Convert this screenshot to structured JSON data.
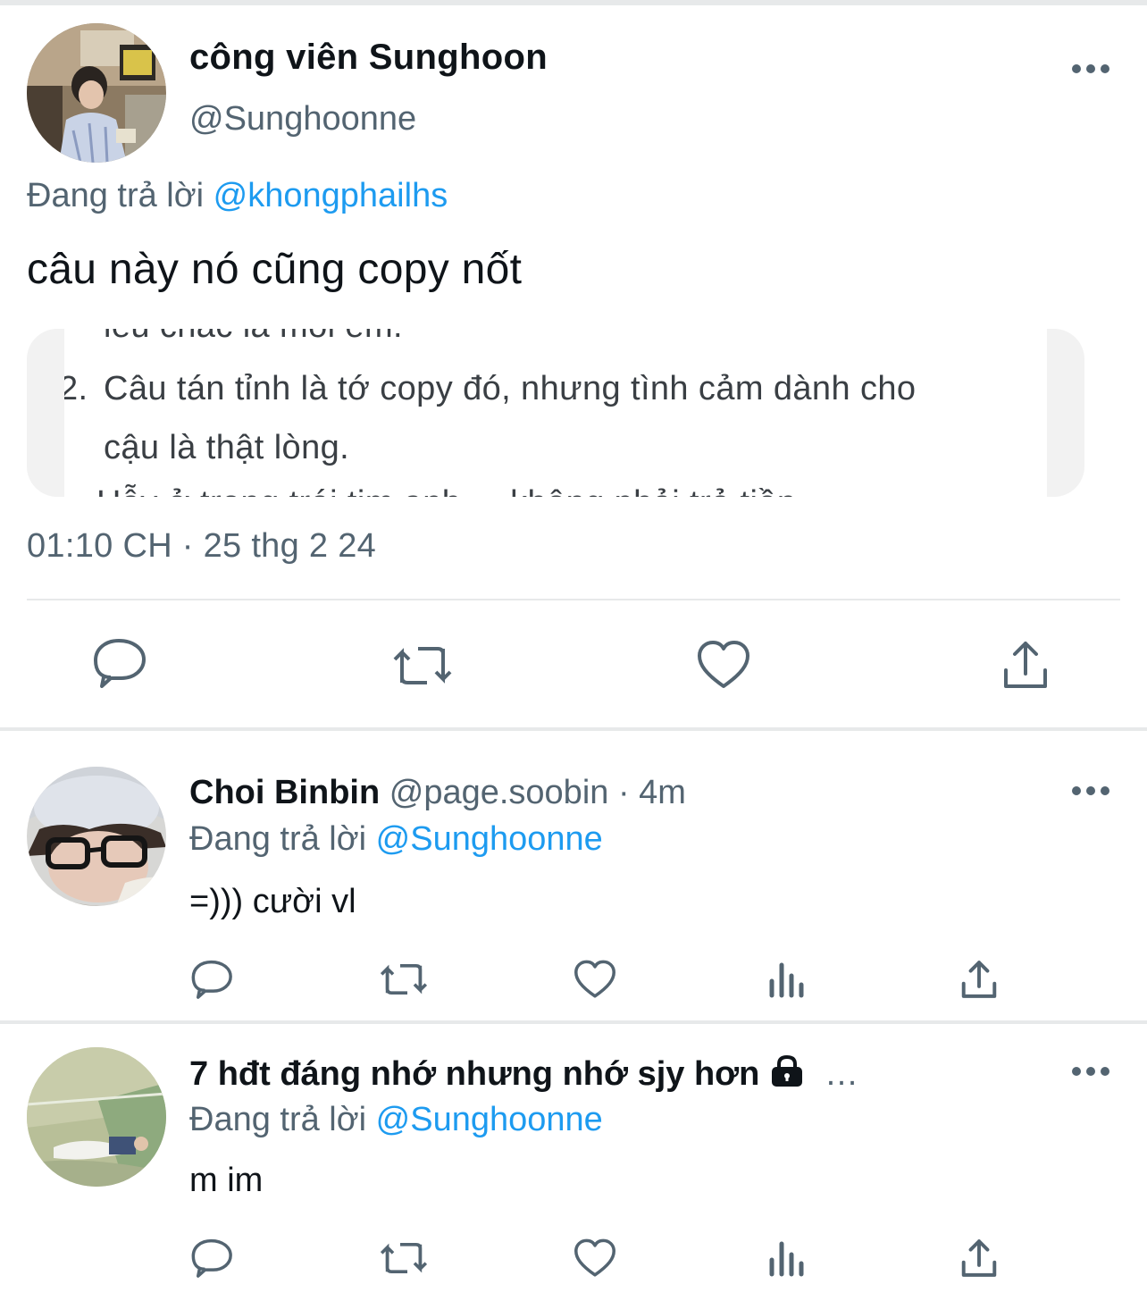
{
  "main_tweet": {
    "author_name": "công viên Sunghoon",
    "author_handle": "@Sunghoonne",
    "replying_prefix": "Đang trả lời",
    "replying_to": "@khongphailhs",
    "text": "câu này nó cũng copy nốt",
    "media": {
      "line_partial_top": "ieu chac la moi em.",
      "list_number": "2.",
      "line1": "Câu tán tỉnh là tớ copy đó, nhưng tình cảm dành cho",
      "line2": "cậu là thật lòng.",
      "line_partial_bottom": "Hẫy ở trọng trái tim anh ... không phải trả tiền ..."
    },
    "timestamp": "01:10 CH · 25 thg 2 24",
    "actions": [
      "reply-icon",
      "retweet-icon",
      "like-icon",
      "share-icon"
    ]
  },
  "replies": [
    {
      "author_name": "Choi Binbin",
      "author_handle": "@page.soobin",
      "age": " · 4m",
      "replying_prefix": "Đang trả lời",
      "replying_to": "@Sunghoonne",
      "text": "=))) cười vl",
      "actions": [
        "reply-icon",
        "retweet-icon",
        "like-icon",
        "views-icon",
        "share-icon"
      ]
    },
    {
      "author_name": "7 hđt đáng nhớ nhưng nhớ sjy hơn",
      "author_suffix": "…",
      "protected": true,
      "replying_prefix": "Đang trả lời",
      "replying_to": "@Sunghoonne",
      "text": "m im",
      "actions": [
        "reply-icon",
        "retweet-icon",
        "like-icon",
        "views-icon",
        "share-icon"
      ]
    }
  ],
  "colors": {
    "text_primary": "#0f1419",
    "text_secondary": "#536471",
    "link": "#1d9bf0",
    "divider": "#e7e9ea"
  }
}
